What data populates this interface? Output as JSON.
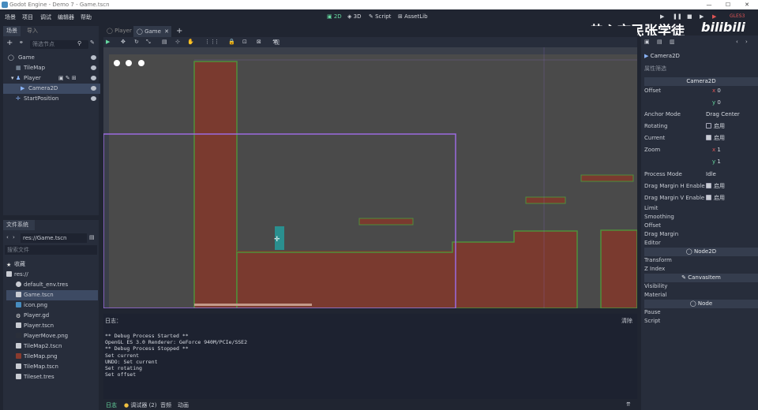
{
  "window": {
    "title": "Godot Engine - Demo 7 - Game.tscn"
  },
  "menu": [
    "场景",
    "项目",
    "调试",
    "编辑器",
    "帮助"
  ],
  "modes": [
    {
      "label": "2D",
      "active": true
    },
    {
      "label": "3D",
      "active": false
    },
    {
      "label": "Script",
      "active": false
    },
    {
      "label": "AssetLib",
      "active": false
    }
  ],
  "renderer": "GLES3",
  "watermark": "热心市民张学徒",
  "watermark_logo": "bilibili",
  "scene_dock": {
    "tabs": [
      "场景",
      "导入"
    ],
    "filter_placeholder": "筛选节点",
    "nodes": [
      {
        "label": "Game",
        "indent": 0
      },
      {
        "label": "TileMap",
        "indent": 1
      },
      {
        "label": "Player",
        "indent": 1
      },
      {
        "label": "Camera2D",
        "indent": 2,
        "selected": true
      },
      {
        "label": "StartPosition",
        "indent": 1
      }
    ]
  },
  "fs_dock": {
    "title": "文件系统",
    "path": "res://Game.tscn",
    "search_placeholder": "搜索文件",
    "items": [
      {
        "label": "收藏",
        "icon": "star-icon",
        "indent": 0
      },
      {
        "label": "res://",
        "icon": "folder-icon",
        "indent": 0
      },
      {
        "label": "default_env.tres",
        "icon": "env-icon",
        "indent": 1
      },
      {
        "label": "Game.tscn",
        "icon": "scene-icon",
        "indent": 1,
        "selected": true
      },
      {
        "label": "icon.png",
        "icon": "image-icon",
        "indent": 1
      },
      {
        "label": "Player.gd",
        "icon": "gear-icon",
        "indent": 1
      },
      {
        "label": "Player.tscn",
        "icon": "scene-icon",
        "indent": 1
      },
      {
        "label": "PlayerMove.png",
        "icon": "image-icon",
        "indent": 1
      },
      {
        "label": "TileMap2.tscn",
        "icon": "scene-icon",
        "indent": 1
      },
      {
        "label": "TileMap.png",
        "icon": "image-icon",
        "indent": 1
      },
      {
        "label": "TileMap.tscn",
        "icon": "scene-icon",
        "indent": 1
      },
      {
        "label": "Tileset.tres",
        "icon": "resource-icon",
        "indent": 1
      }
    ]
  },
  "editor_tabs": [
    {
      "label": "Player",
      "active": false
    },
    {
      "label": "Game",
      "active": true
    }
  ],
  "toolbar": {
    "view_label": "视图"
  },
  "log": {
    "title": "日志：",
    "clear": "清除",
    "lines": [
      "** Debug Process Started **",
      "OpenGL ES 3.0 Renderer: GeForce 940M/PCIe/SSE2",
      "** Debug Process Stopped **",
      "Set current",
      "UNDO: Set current",
      "Set rotating",
      "Set offset"
    ]
  },
  "bottom_tabs": [
    "日志",
    "调试器 (2)",
    "音频",
    "动画"
  ],
  "inspector": {
    "node_label": "Camera2D",
    "filter": "属性筛选",
    "section": "Camera2D",
    "offset_x": "0",
    "offset_y": "0",
    "props": [
      {
        "label": "Anchor Mode",
        "value": "Drag Center"
      },
      {
        "label": "Rotating",
        "value": "启用",
        "checked": false
      },
      {
        "label": "Current",
        "value": "启用",
        "checked": true
      },
      {
        "label": "Process Mode",
        "value": "Idle"
      },
      {
        "label": "Drag Margin H Enable",
        "value": "启用",
        "checked": true
      },
      {
        "label": "Drag Margin V Enable",
        "value": "启用",
        "checked": true
      }
    ],
    "zoom_x": "1",
    "zoom_y": "1",
    "groups1": [
      "Limit",
      "Smoothing",
      "Offset",
      "Drag Margin",
      "Editor"
    ],
    "section2": "Node2D",
    "groups2": [
      "Transform",
      "Z Index"
    ],
    "section3": "CanvasItem",
    "groups3": [
      "Visibility",
      "Material"
    ],
    "section4": "Node",
    "groups4": [
      "Pause",
      "Script"
    ]
  },
  "colors": {
    "wall": "#7a3a2f",
    "grass": "#4f8f3a",
    "camera_rect": "#9b6be0",
    "player": "#2a8f8f"
  }
}
